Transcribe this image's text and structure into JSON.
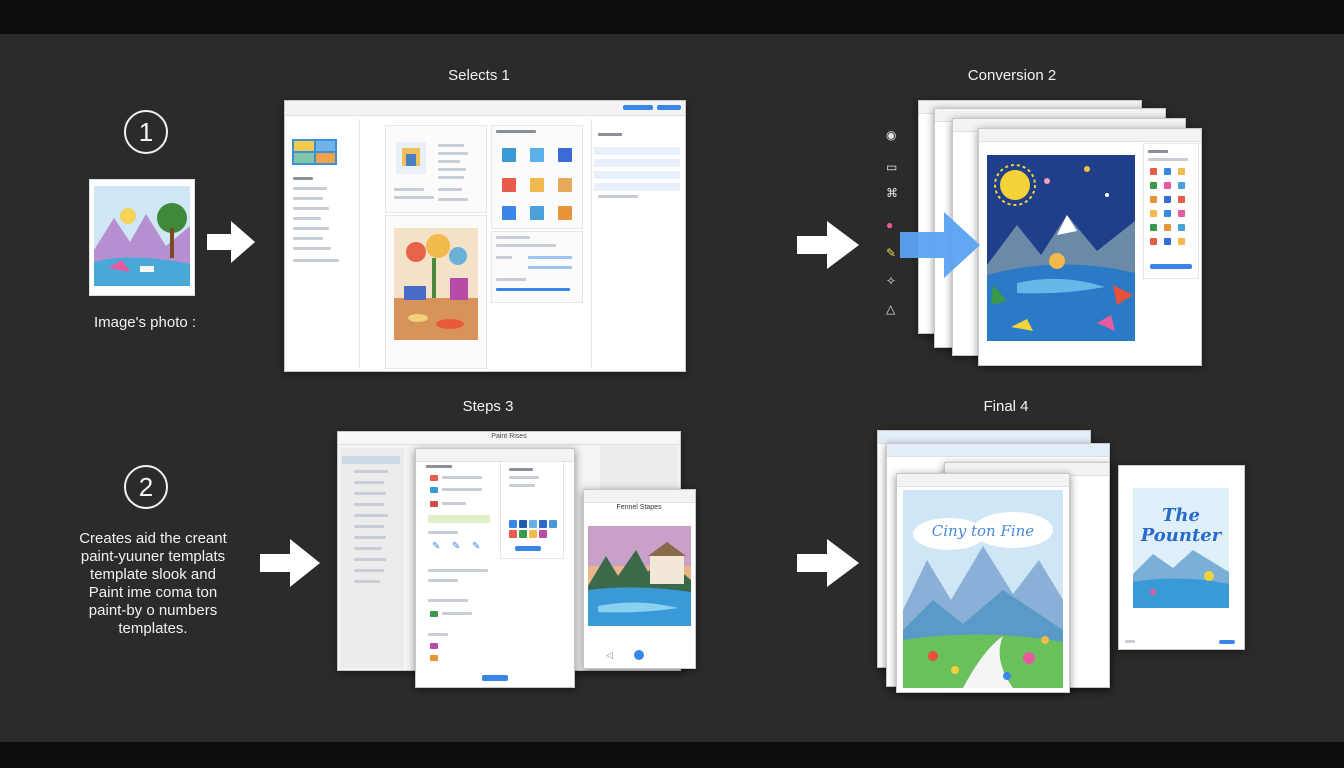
{
  "steps": [
    {
      "title": "Selects 1"
    },
    {
      "title": "Conversion 2"
    },
    {
      "title": "Steps 3"
    },
    {
      "title": "Final 4"
    }
  ],
  "left": {
    "num1": "1",
    "num2": "2",
    "photo_caption": "Image's photo :",
    "caption2_lines": [
      "Creates aid the creant",
      "paint-yuuner templats",
      "template slook and",
      "Paint ime coma ton",
      "paint-by o numbers",
      "templates."
    ]
  },
  "final": {
    "poster_big_text": "Ciny ton Fine",
    "poster_small_text": "The Pounter"
  },
  "step3": {
    "window_title": "Paint Rises",
    "preview_title": "Fennel Stapes"
  },
  "colors": {
    "background": "#2b2b2b",
    "band": "#0d0d0d",
    "accent_blue": "#3a86e8",
    "arrow_white": "#ffffff",
    "arrow_blue": "#5aa2f0"
  },
  "icons": [
    "target-icon",
    "document-icon",
    "tag-icon",
    "palette-icon",
    "pen-icon",
    "user-icon",
    "bell-icon"
  ]
}
